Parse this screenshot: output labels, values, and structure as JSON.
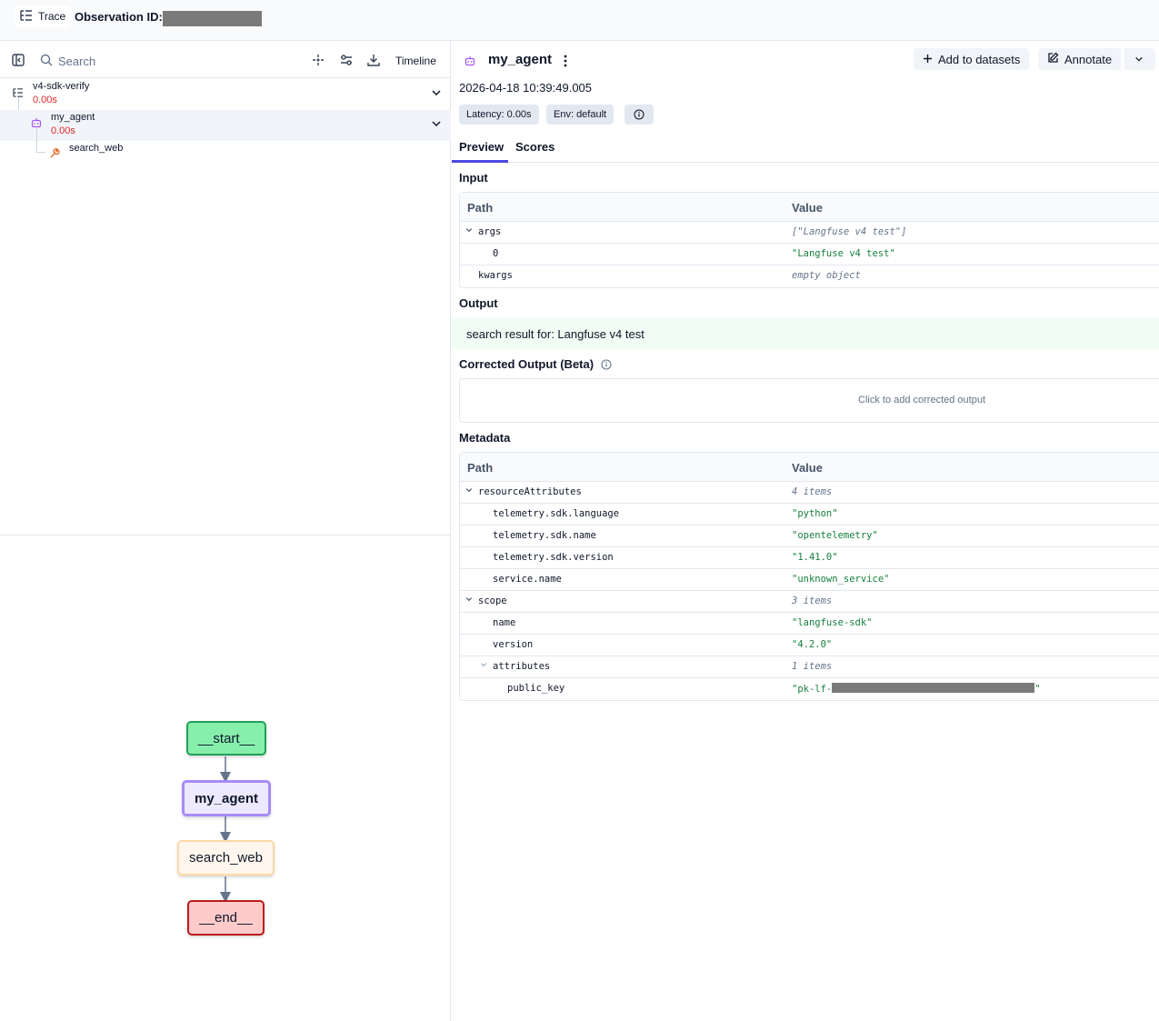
{
  "header": {
    "trace_label": "Trace",
    "observation_label": "Observation ID:",
    "observation_id_redacted": true
  },
  "left_toolbar": {
    "search_placeholder": "Search",
    "timeline_label": "Timeline"
  },
  "tree": {
    "items": [
      {
        "name": "v4-sdk-verify",
        "time": "0.00s",
        "icon": "trace-list-icon"
      },
      {
        "name": "my_agent",
        "time": "0.00s",
        "icon": "agent-bot-icon",
        "selected": true
      },
      {
        "name": "search_web",
        "time": "",
        "icon": "tool-wrench-icon"
      }
    ]
  },
  "graph": {
    "nodes": [
      "__start__",
      "my_agent",
      "search_web",
      "__end__"
    ]
  },
  "detail": {
    "title": "my_agent",
    "add_to_datasets": "Add to datasets",
    "annotate": "Annotate",
    "timestamp": "2026-04-18 10:39:49.005",
    "latency": "Latency: 0.00s",
    "env": "Env: default",
    "tabs": [
      "Preview",
      "Scores"
    ],
    "input_title": "Input",
    "path_header": "Path",
    "value_header": "Value",
    "input_rows": [
      {
        "key": "args",
        "value": "[\"Langfuse v4 test\"]"
      },
      {
        "key": "0",
        "value": "\"Langfuse v4 test\""
      },
      {
        "key": "kwargs",
        "value": "empty object"
      }
    ],
    "output_title": "Output",
    "output_text": "search result for: Langfuse v4 test",
    "corrected_title": "Corrected Output (Beta)",
    "corrected_placeholder": "Click to add corrected output",
    "metadata_title": "Metadata",
    "metadata_rows": [
      {
        "key": "resourceAttributes",
        "value": "4 items"
      },
      {
        "key": "telemetry.sdk.language",
        "value": "\"python\""
      },
      {
        "key": "telemetry.sdk.name",
        "value": "\"opentelemetry\""
      },
      {
        "key": "telemetry.sdk.version",
        "value": "\"1.41.0\""
      },
      {
        "key": "service.name",
        "value": "\"unknown_service\""
      },
      {
        "key": "scope",
        "value": "3 items"
      },
      {
        "key": "name",
        "value": "\"langfuse-sdk\""
      },
      {
        "key": "version",
        "value": "\"4.2.0\""
      },
      {
        "key": "attributes",
        "value": "1 items"
      },
      {
        "key": "public_key",
        "value_prefix": "\"pk-lf-",
        "value_suffix": "\""
      }
    ]
  },
  "colors": {
    "accent": "#4f46e5",
    "latency_red": "#dc2626",
    "string_green": "#15803d",
    "start_node": "#86efac",
    "agent_node_border": "#a78bfa",
    "tool_node_border": "#fcd9a8",
    "end_node": "#fecaca"
  }
}
